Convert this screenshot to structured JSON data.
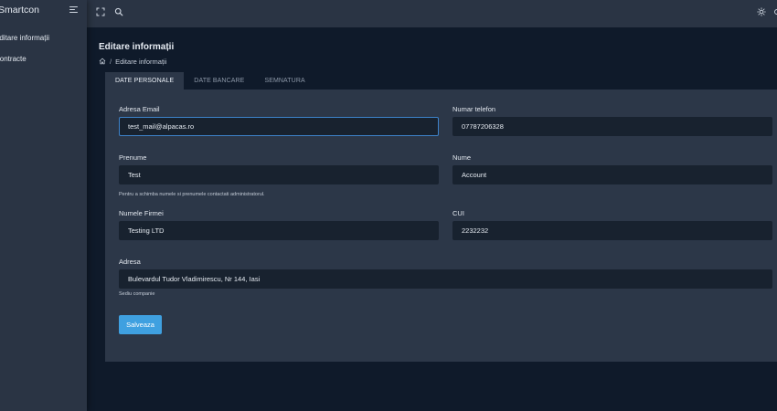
{
  "app": {
    "brand": "Smartcon"
  },
  "sidebar": {
    "items": [
      {
        "label": "Editare informații"
      },
      {
        "label": "Contracte"
      }
    ]
  },
  "page": {
    "title": "Editare informații",
    "breadcrumb": {
      "separator": "/",
      "current": "Editare informații"
    }
  },
  "tabs": [
    {
      "label": "DATE PERSONALE",
      "active": true
    },
    {
      "label": "DATE BANCARE",
      "active": false
    },
    {
      "label": "SEMNATURA",
      "active": false
    }
  ],
  "form": {
    "email": {
      "label": "Adresa Email",
      "value": "test_mail@alpacas.ro"
    },
    "phone": {
      "label": "Numar telefon",
      "value": "07787206328"
    },
    "first_name": {
      "label": "Prenume",
      "value": "Test"
    },
    "last_name": {
      "label": "Nume",
      "value": "Account"
    },
    "name_hint": "Pentru a schimba numele si prenumele contactati administratorul.",
    "company": {
      "label": "Numele Firmei",
      "value": "Testing LTD"
    },
    "cui": {
      "label": "CUI",
      "value": "2232232"
    },
    "address": {
      "label": "Adresa",
      "value": "Bulevardul Tudor Vladimirescu, Nr 144, Iasi"
    },
    "address_hint": "Sediu companie",
    "save_label": "Salveaza"
  },
  "colors": {
    "background": "#0f1a2a",
    "sidebar": "#2a3444",
    "card": "#2c3748",
    "input": "#18222f",
    "accent": "#3fa0e0",
    "focus": "#3d82c9"
  },
  "icons": {
    "menu_toggle": "menu-toggle-icon",
    "fullscreen": "fullscreen-icon",
    "search": "search-icon",
    "theme": "sun-icon",
    "home": "home-icon"
  }
}
